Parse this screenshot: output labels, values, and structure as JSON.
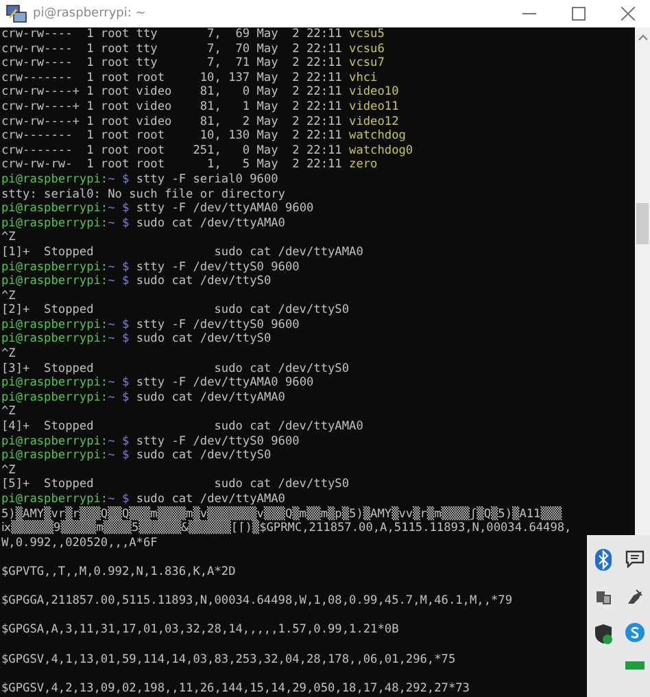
{
  "window": {
    "title": "pi@raspberrypi: ~"
  },
  "lines": [
    {
      "kind": "ls",
      "text": "crw-rw----  1 root tty       7,  69 May  2 22:11",
      "name": "vcsu5"
    },
    {
      "kind": "ls",
      "text": "crw-rw----  1 root tty       7,  70 May  2 22:11",
      "name": "vcsu6"
    },
    {
      "kind": "ls",
      "text": "crw-rw----  1 root tty       7,  71 May  2 22:11",
      "name": "vcsu7"
    },
    {
      "kind": "ls",
      "text": "crw-------  1 root root     10, 137 May  2 22:11",
      "name": "vhci"
    },
    {
      "kind": "ls",
      "text": "crw-rw----+ 1 root video    81,   0 May  2 22:11",
      "name": "video10"
    },
    {
      "kind": "ls",
      "text": "crw-rw----+ 1 root video    81,   1 May  2 22:11",
      "name": "video11"
    },
    {
      "kind": "ls",
      "text": "crw-rw----+ 1 root video    81,   2 May  2 22:11",
      "name": "video12"
    },
    {
      "kind": "ls",
      "text": "crw-------  1 root root     10, 130 May  2 22:11",
      "name": "watchdog"
    },
    {
      "kind": "ls",
      "text": "crw-------  1 root root    251,   0 May  2 22:11",
      "name": "watchdog0"
    },
    {
      "kind": "ls",
      "text": "crw-rw-rw-  1 root root      1,   5 May  2 22:11",
      "name": "zero"
    },
    {
      "kind": "prompt",
      "user": "pi@raspberrypi:",
      "path": "~",
      "symbol": "$",
      "command": "stty -F serial0 9600"
    },
    {
      "kind": "output",
      "text": "stty: serial0: No such file or directory"
    },
    {
      "kind": "prompt",
      "user": "pi@raspberrypi:",
      "path": "~",
      "symbol": "$",
      "command": "stty -F /dev/ttyAMA0 9600"
    },
    {
      "kind": "prompt",
      "user": "pi@raspberrypi:",
      "path": "~",
      "symbol": "$",
      "command": "sudo cat /dev/ttyAMA0"
    },
    {
      "kind": "output",
      "text": "^Z"
    },
    {
      "kind": "output",
      "text": "[1]+  Stopped                 sudo cat /dev/ttyAMA0"
    },
    {
      "kind": "prompt",
      "user": "pi@raspberrypi:",
      "path": "~",
      "symbol": "$",
      "command": "stty -F /dev/ttyS0 9600"
    },
    {
      "kind": "prompt",
      "user": "pi@raspberrypi:",
      "path": "~",
      "symbol": "$",
      "command": "sudo cat /dev/ttyS0"
    },
    {
      "kind": "output",
      "text": "^Z"
    },
    {
      "kind": "output",
      "text": "[2]+  Stopped                 sudo cat /dev/ttyS0"
    },
    {
      "kind": "prompt",
      "user": "pi@raspberrypi:",
      "path": "~",
      "symbol": "$",
      "command": "stty -F /dev/ttyS0 9600"
    },
    {
      "kind": "prompt",
      "user": "pi@raspberrypi:",
      "path": "~",
      "symbol": "$",
      "command": "sudo cat /dev/ttyS0"
    },
    {
      "kind": "output",
      "text": "^Z"
    },
    {
      "kind": "output",
      "text": "[3]+  Stopped                 sudo cat /dev/ttyS0"
    },
    {
      "kind": "prompt",
      "user": "pi@raspberrypi:",
      "path": "~",
      "symbol": "$",
      "command": "stty -F /dev/ttyAMA0 9600"
    },
    {
      "kind": "prompt",
      "user": "pi@raspberrypi:",
      "path": "~",
      "symbol": "$",
      "command": "sudo cat /dev/ttyAMA0"
    },
    {
      "kind": "output",
      "text": "^Z"
    },
    {
      "kind": "output",
      "text": "[4]+  Stopped                 sudo cat /dev/ttyAMA0"
    },
    {
      "kind": "prompt",
      "user": "pi@raspberrypi:",
      "path": "~",
      "symbol": "$",
      "command": "stty -F /dev/ttyS0 9600"
    },
    {
      "kind": "prompt",
      "user": "pi@raspberrypi:",
      "path": "~",
      "symbol": "$",
      "command": "sudo cat /dev/ttyS0"
    },
    {
      "kind": "output",
      "text": "^Z"
    },
    {
      "kind": "output",
      "text": "[5]+  Stopped                 sudo cat /dev/ttyS0"
    },
    {
      "kind": "prompt",
      "user": "pi@raspberrypi:",
      "path": "~",
      "symbol": "$",
      "command": "sudo cat /dev/ttyAMA0"
    },
    {
      "kind": "output",
      "text": "5)▒AMY▒vr▒r▒▒▒Q▒▒Q▒▒▒m▒▒▒▒m▒v▒▒▒▒▒▒▒v▒▒▒Q▒m▒▒m▒p▒5)▒AMY▒vv▒r▒m▒▒▒▒ʃ▒Q▒5)▒A11▒▒▒"
    },
    {
      "kind": "output",
      "text": "ⅸ▒▒▒▒▒▒9▒▒▒▒▒m▒▒▒▒5▒▒▒▒▒▒&▒▒▒▒▒▒[⌈)▒$GPRMC,211857.00,A,5115.11893,N,00034.64498,"
    },
    {
      "kind": "output",
      "text": "W,0.992,,020520,,,A*6F"
    },
    {
      "kind": "blank"
    },
    {
      "kind": "output",
      "text": "$GPVTG,,T,,M,0.992,N,1.836,K,A*2D"
    },
    {
      "kind": "blank"
    },
    {
      "kind": "output",
      "text": "$GPGGA,211857.00,5115.11893,N,00034.64498,W,1,08,0.99,45.7,M,46.1,M,,*79"
    },
    {
      "kind": "blank"
    },
    {
      "kind": "output",
      "text": "$GPGSA,A,3,11,31,17,01,03,32,28,14,,,,,1.57,0.99,1.21*0B"
    },
    {
      "kind": "blank"
    },
    {
      "kind": "output",
      "text": "$GPGSV,4,1,13,01,59,114,14,03,83,253,32,04,28,178,,06,01,296,*75"
    },
    {
      "kind": "blank"
    },
    {
      "kind": "output",
      "text": "$GPGSV,4,2,13,09,02,198,,11,26,144,15,14,29,050,18,17,48,292,27*73"
    }
  ]
}
